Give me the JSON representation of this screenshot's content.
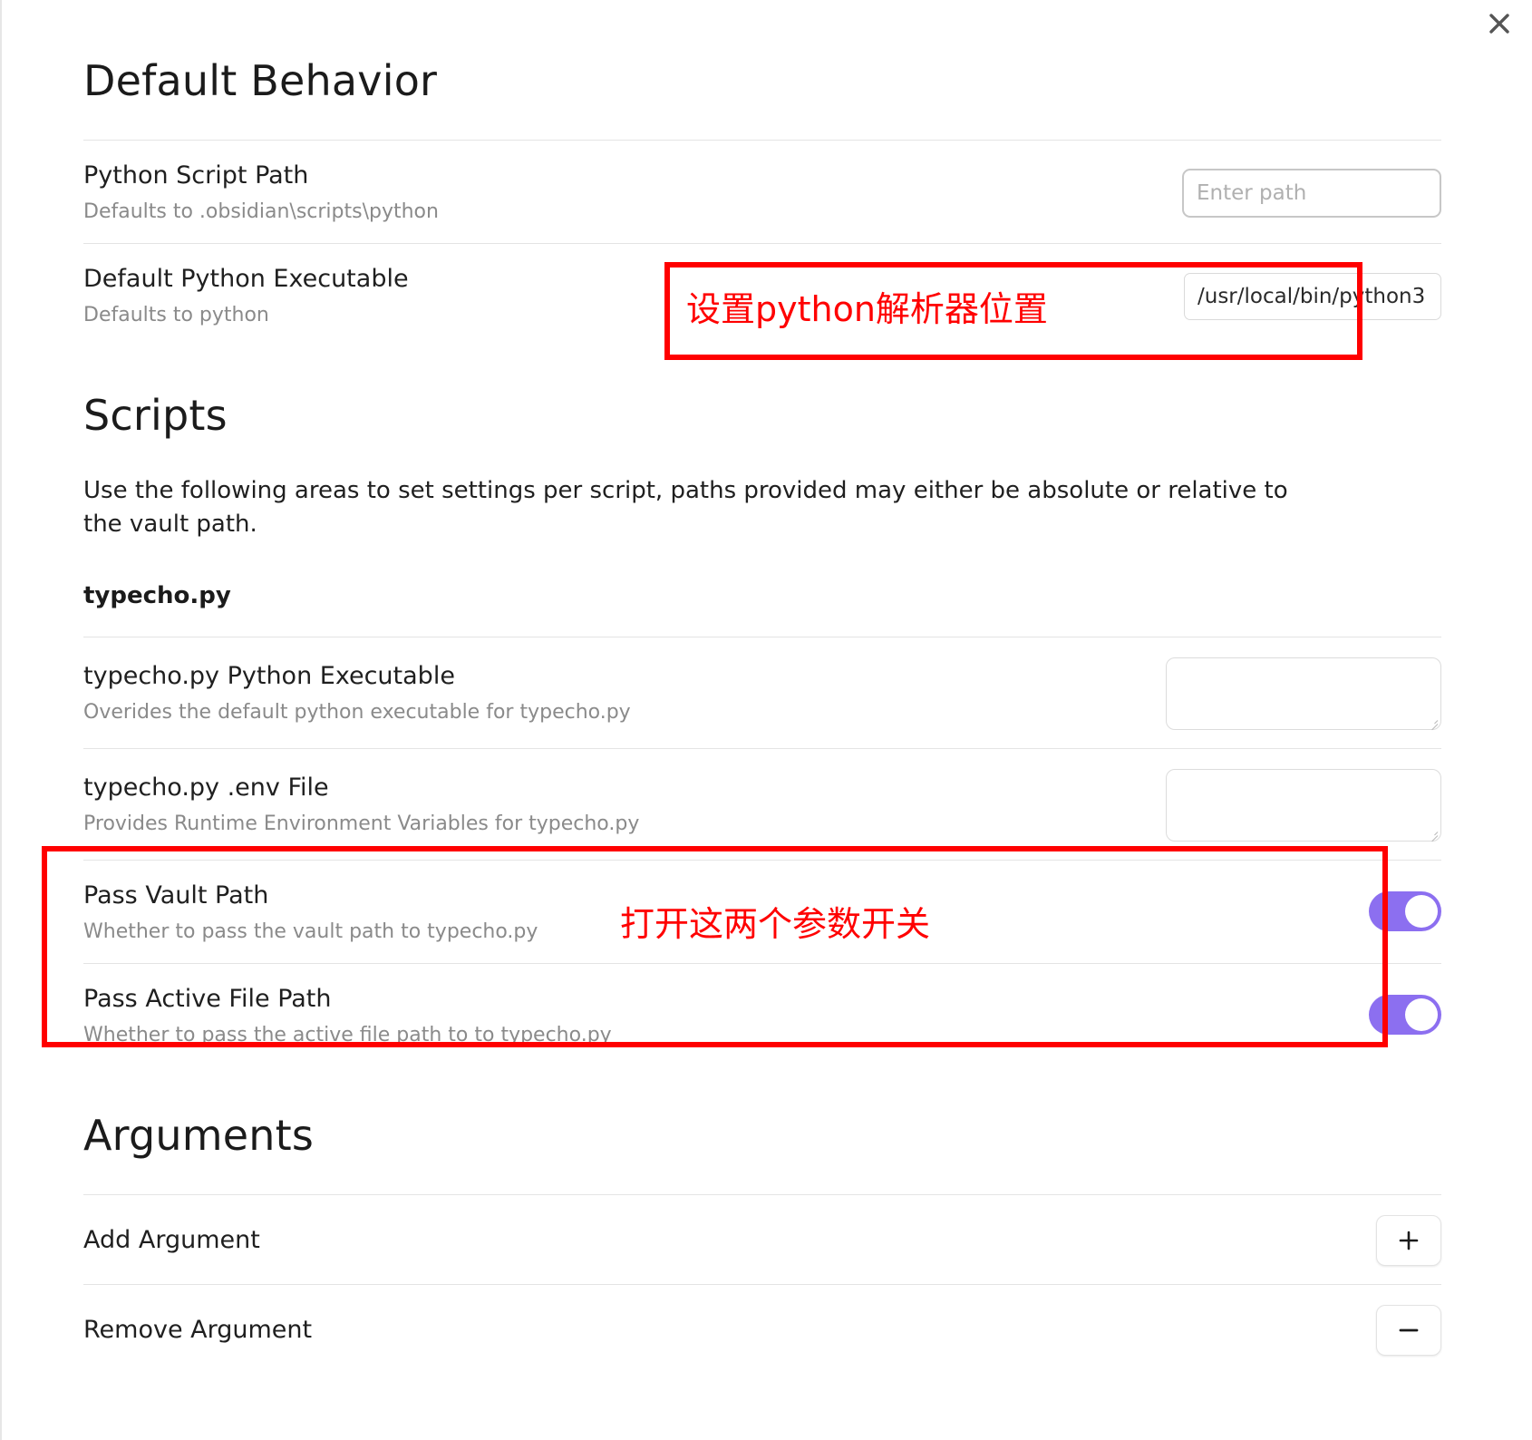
{
  "window": {
    "close_icon": "close-icon"
  },
  "default_behavior": {
    "title": "Default Behavior",
    "settings": [
      {
        "name": "Python Script Path",
        "desc": "Defaults to .obsidian\\scripts\\python",
        "placeholder": "Enter path",
        "value": ""
      },
      {
        "name": "Default Python Executable",
        "desc": "Defaults to python",
        "placeholder": "",
        "value": "/usr/local/bin/python3"
      }
    ]
  },
  "scripts": {
    "title": "Scripts",
    "description": "Use the following areas to set settings per script, paths provided may either be absolute or relative to the vault path.",
    "script_name": "typecho.py",
    "settings": [
      {
        "name": "typecho.py Python Executable",
        "desc": "Overides the default python executable for typecho.py",
        "value": ""
      },
      {
        "name": "typecho.py .env File",
        "desc": "Provides Runtime Environment Variables for typecho.py",
        "value": ""
      }
    ],
    "toggles": [
      {
        "name": "Pass Vault Path",
        "desc": "Whether to pass the vault path to typecho.py",
        "state": "on"
      },
      {
        "name": "Pass Active File Path",
        "desc": "Whether to pass the active file path to to typecho.py",
        "state": "on"
      }
    ]
  },
  "arguments": {
    "title": "Arguments",
    "rows": [
      {
        "name": "Add Argument",
        "icon": "plus-icon"
      },
      {
        "name": "Remove Argument",
        "icon": "minus-icon"
      }
    ]
  },
  "annotations": {
    "python_path": "设置python解析器位置",
    "toggles": "打开这两个参数开关",
    "color": "#ff0000"
  }
}
